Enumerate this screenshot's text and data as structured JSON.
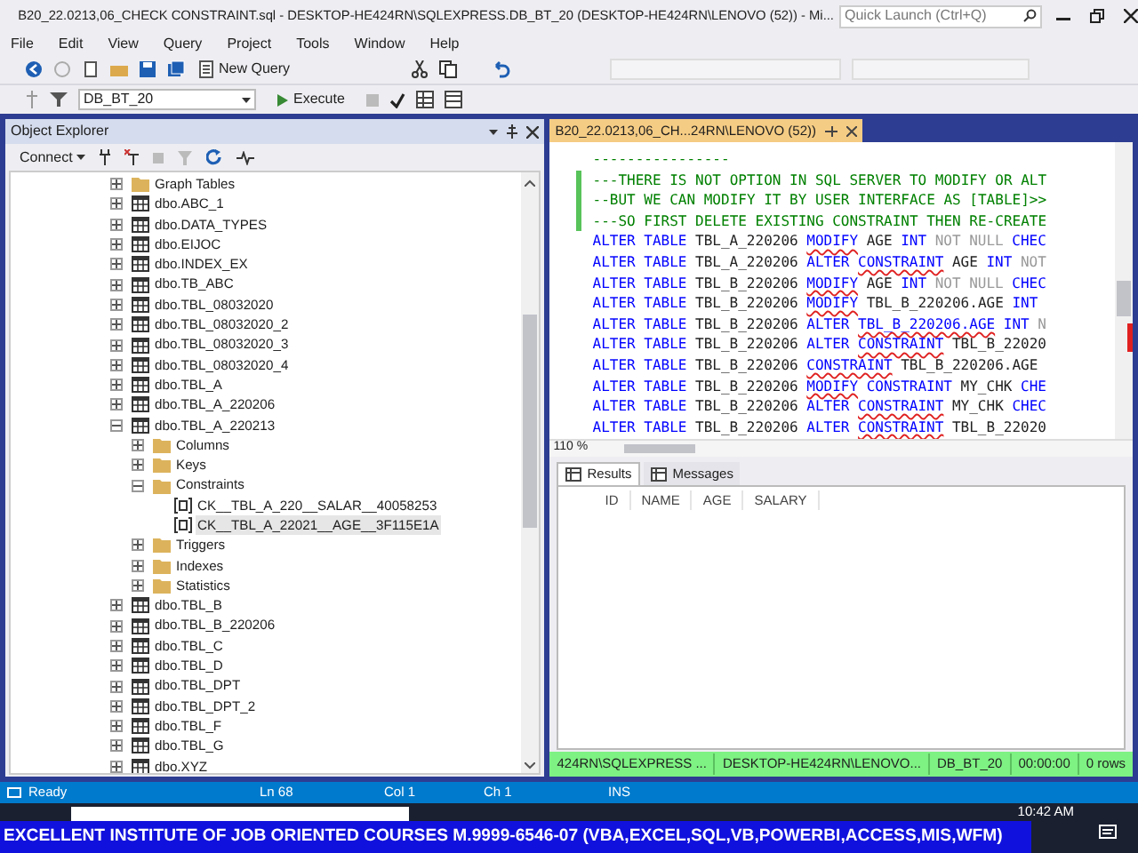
{
  "window": {
    "title": "B20_22.0213,06_CHECK CONSTRAINT.sql - DESKTOP-HE424RN\\SQLEXPRESS.DB_BT_20 (DESKTOP-HE424RN\\LENOVO (52)) - Mi...",
    "quick_launch": {
      "placeholder": "Quick Launch (Ctrl+Q)"
    }
  },
  "menu": [
    "File",
    "Edit",
    "View",
    "Query",
    "Project",
    "Tools",
    "Window",
    "Help"
  ],
  "toolbar": {
    "new_query": "New Query",
    "database": "DB_BT_20",
    "execute": "Execute"
  },
  "object_explorer": {
    "title": "Object Explorer",
    "connect": "Connect",
    "tree": [
      {
        "label": "Graph Tables",
        "kind": "folder",
        "expanded": false,
        "selected": false
      },
      {
        "label": "dbo.ABC_1",
        "kind": "table",
        "expanded": false,
        "selected": false
      },
      {
        "label": "dbo.DATA_TYPES",
        "kind": "table",
        "expanded": false,
        "selected": false
      },
      {
        "label": "dbo.EIJOC",
        "kind": "table",
        "expanded": false,
        "selected": false
      },
      {
        "label": "dbo.INDEX_EX",
        "kind": "table",
        "expanded": false,
        "selected": false
      },
      {
        "label": "dbo.TB_ABC",
        "kind": "table",
        "expanded": false,
        "selected": false
      },
      {
        "label": "dbo.TBL_08032020",
        "kind": "table",
        "expanded": false,
        "selected": false
      },
      {
        "label": "dbo.TBL_08032020_2",
        "kind": "table",
        "expanded": false,
        "selected": false
      },
      {
        "label": "dbo.TBL_08032020_3",
        "kind": "table",
        "expanded": false,
        "selected": false
      },
      {
        "label": "dbo.TBL_08032020_4",
        "kind": "table",
        "expanded": false,
        "selected": false
      },
      {
        "label": "dbo.TBL_A",
        "kind": "table",
        "expanded": false,
        "selected": false
      },
      {
        "label": "dbo.TBL_A_220206",
        "kind": "table",
        "expanded": false,
        "selected": false
      },
      {
        "label": "dbo.TBL_A_220213",
        "kind": "table",
        "expanded": true,
        "selected": false,
        "children": [
          {
            "label": "Columns",
            "kind": "folder",
            "expanded": false,
            "selected": false
          },
          {
            "label": "Keys",
            "kind": "folder",
            "expanded": false,
            "selected": false
          },
          {
            "label": "Constraints",
            "kind": "folder",
            "expanded": true,
            "selected": false,
            "children": [
              {
                "label": "CK__TBL_A_220__SALAR__40058253",
                "kind": "constraint",
                "selected": false
              },
              {
                "label": "CK__TBL_A_22021__AGE__3F115E1A",
                "kind": "constraint",
                "selected": true
              }
            ]
          },
          {
            "label": "Triggers",
            "kind": "folder",
            "expanded": false,
            "selected": false
          },
          {
            "label": "Indexes",
            "kind": "folder",
            "expanded": false,
            "selected": false
          },
          {
            "label": "Statistics",
            "kind": "folder",
            "expanded": false,
            "selected": false
          }
        ]
      },
      {
        "label": "dbo.TBL_B",
        "kind": "table",
        "expanded": false,
        "selected": false
      },
      {
        "label": "dbo.TBL_B_220206",
        "kind": "table",
        "expanded": false,
        "selected": false
      },
      {
        "label": "dbo.TBL_C",
        "kind": "table",
        "expanded": false,
        "selected": false
      },
      {
        "label": "dbo.TBL_D",
        "kind": "table",
        "expanded": false,
        "selected": false
      },
      {
        "label": "dbo.TBL_DPT",
        "kind": "table",
        "expanded": false,
        "selected": false
      },
      {
        "label": "dbo.TBL_DPT_2",
        "kind": "table",
        "expanded": false,
        "selected": false
      },
      {
        "label": "dbo.TBL_F",
        "kind": "table",
        "expanded": false,
        "selected": false
      },
      {
        "label": "dbo.TBL_G",
        "kind": "table",
        "expanded": false,
        "selected": false
      },
      {
        "label": "dbo.XYZ",
        "kind": "table",
        "expanded": false,
        "selected": false
      }
    ]
  },
  "editor": {
    "tab": {
      "title": "B20_22.0213,06_CH...24RN\\LENOVO (52))",
      "selected": true
    },
    "zoom": "110 %",
    "lines": [
      {
        "changed": false,
        "tokens": [
          {
            "text": "----------------",
            "kind": "comment"
          }
        ]
      },
      {
        "changed": true,
        "tokens": [
          {
            "text": "---THERE IS NOT OPTION IN SQL SERVER TO MODIFY OR ALT",
            "kind": "comment"
          }
        ]
      },
      {
        "changed": true,
        "tokens": [
          {
            "text": "--BUT WE CAN MODIFY IT BY USER INTERFACE AS [TABLE]>>",
            "kind": "comment"
          }
        ]
      },
      {
        "changed": true,
        "tokens": [
          {
            "text": "---SO FIRST DELETE EXISTING CONSTRAINT THEN RE-CREATE",
            "kind": "comment"
          }
        ]
      },
      {
        "changed": false,
        "tokens": [
          {
            "text": "ALTER",
            "kind": "keyword"
          },
          {
            "text": "TABLE",
            "kind": "keyword"
          },
          {
            "text": "TBL_A_220206",
            "kind": "name"
          },
          {
            "text": "MODIFY",
            "kind": "flagged"
          },
          {
            "text": "AGE",
            "kind": "name"
          },
          {
            "text": "INT",
            "kind": "keyword"
          },
          {
            "text": "NOT NULL",
            "kind": "dim"
          },
          {
            "text": "CHEC",
            "kind": "keyword"
          }
        ]
      },
      {
        "changed": false,
        "tokens": [
          {
            "text": "ALTER",
            "kind": "keyword"
          },
          {
            "text": "TABLE",
            "kind": "keyword"
          },
          {
            "text": "TBL_A_220206",
            "kind": "name"
          },
          {
            "text": "ALTER",
            "kind": "keyword"
          },
          {
            "text": "CONSTRAINT",
            "kind": "flagged"
          },
          {
            "text": "AGE",
            "kind": "name"
          },
          {
            "text": "INT",
            "kind": "keyword"
          },
          {
            "text": "NOT",
            "kind": "dim"
          }
        ]
      },
      {
        "changed": false,
        "tokens": [
          {
            "text": "ALTER",
            "kind": "keyword"
          },
          {
            "text": "TABLE",
            "kind": "keyword"
          },
          {
            "text": "TBL_B_220206",
            "kind": "name"
          },
          {
            "text": "MODIFY",
            "kind": "flagged"
          },
          {
            "text": "AGE",
            "kind": "name"
          },
          {
            "text": "INT",
            "kind": "keyword"
          },
          {
            "text": "NOT NULL",
            "kind": "dim"
          },
          {
            "text": "CHEC",
            "kind": "keyword"
          }
        ]
      },
      {
        "changed": false,
        "tokens": [
          {
            "text": "ALTER",
            "kind": "keyword"
          },
          {
            "text": "TABLE",
            "kind": "keyword"
          },
          {
            "text": "TBL_B_220206",
            "kind": "name"
          },
          {
            "text": "MODIFY",
            "kind": "flagged"
          },
          {
            "text": "TBL_B_220206.AGE",
            "kind": "name"
          },
          {
            "text": "INT",
            "kind": "keyword"
          }
        ]
      },
      {
        "changed": false,
        "tokens": [
          {
            "text": "ALTER",
            "kind": "keyword"
          },
          {
            "text": "TABLE",
            "kind": "keyword"
          },
          {
            "text": "TBL_B_220206",
            "kind": "name"
          },
          {
            "text": "ALTER",
            "kind": "keyword"
          },
          {
            "text": "TBL_B_220206.AGE",
            "kind": "flagged"
          },
          {
            "text": "INT",
            "kind": "keyword"
          },
          {
            "text": "N",
            "kind": "dim"
          }
        ]
      },
      {
        "changed": false,
        "tokens": [
          {
            "text": "ALTER",
            "kind": "keyword"
          },
          {
            "text": "TABLE",
            "kind": "keyword"
          },
          {
            "text": "TBL_B_220206",
            "kind": "name"
          },
          {
            "text": "ALTER",
            "kind": "keyword"
          },
          {
            "text": "CONSTRAINT",
            "kind": "flagged"
          },
          {
            "text": "TBL_B_22020",
            "kind": "name"
          }
        ]
      },
      {
        "changed": false,
        "tokens": [
          {
            "text": "ALTER",
            "kind": "keyword"
          },
          {
            "text": "TABLE",
            "kind": "keyword"
          },
          {
            "text": "TBL_B_220206",
            "kind": "name"
          },
          {
            "text": "CONSTRAINT",
            "kind": "flagged"
          },
          {
            "text": "TBL_B_220206.AGE",
            "kind": "name"
          }
        ]
      },
      {
        "changed": false,
        "tokens": [
          {
            "text": "ALTER",
            "kind": "keyword"
          },
          {
            "text": "TABLE",
            "kind": "keyword"
          },
          {
            "text": "TBL_B_220206",
            "kind": "name"
          },
          {
            "text": "MODIFY",
            "kind": "flagged"
          },
          {
            "text": "CONSTRAINT",
            "kind": "keyword"
          },
          {
            "text": "MY_CHK",
            "kind": "name"
          },
          {
            "text": "CHE",
            "kind": "keyword"
          }
        ]
      },
      {
        "changed": false,
        "tokens": [
          {
            "text": "ALTER",
            "kind": "keyword"
          },
          {
            "text": "TABLE",
            "kind": "keyword"
          },
          {
            "text": "TBL_B_220206",
            "kind": "name"
          },
          {
            "text": "ALTER",
            "kind": "keyword"
          },
          {
            "text": "CONSTRAINT",
            "kind": "flagged"
          },
          {
            "text": "MY_CHK",
            "kind": "name"
          },
          {
            "text": "CHEC",
            "kind": "keyword"
          }
        ]
      },
      {
        "changed": false,
        "tokens": [
          {
            "text": "ALTER",
            "kind": "keyword"
          },
          {
            "text": "TABLE",
            "kind": "keyword"
          },
          {
            "text": "TBL_B_220206",
            "kind": "name"
          },
          {
            "text": "ALTER",
            "kind": "keyword"
          },
          {
            "text": "CONSTRAINT",
            "kind": "flagged"
          },
          {
            "text": "TBL_B_22020",
            "kind": "name"
          }
        ]
      }
    ]
  },
  "results": {
    "tabs": [
      {
        "label": "Results",
        "selected": true
      },
      {
        "label": "Messages",
        "selected": false
      }
    ],
    "columns": [
      "ID",
      "NAME",
      "AGE",
      "SALARY"
    ]
  },
  "query_status": [
    "424RN\\SQLEXPRESS ...",
    "DESKTOP-HE424RN\\LENOVO...",
    "DB_BT_20",
    "00:00:00",
    "0 rows"
  ],
  "status_bar": [
    "Ready",
    "Ln 68",
    "Col 1",
    "Ch 1",
    "INS"
  ],
  "banner": "EXCELLENT INSTITUTE OF JOB ORIENTED COURSES M.9999-6546-07 (VBA,EXCEL,SQL,VB,POWERBI,ACCESS,MIS,WFM)",
  "clock": "10:42 AM"
}
